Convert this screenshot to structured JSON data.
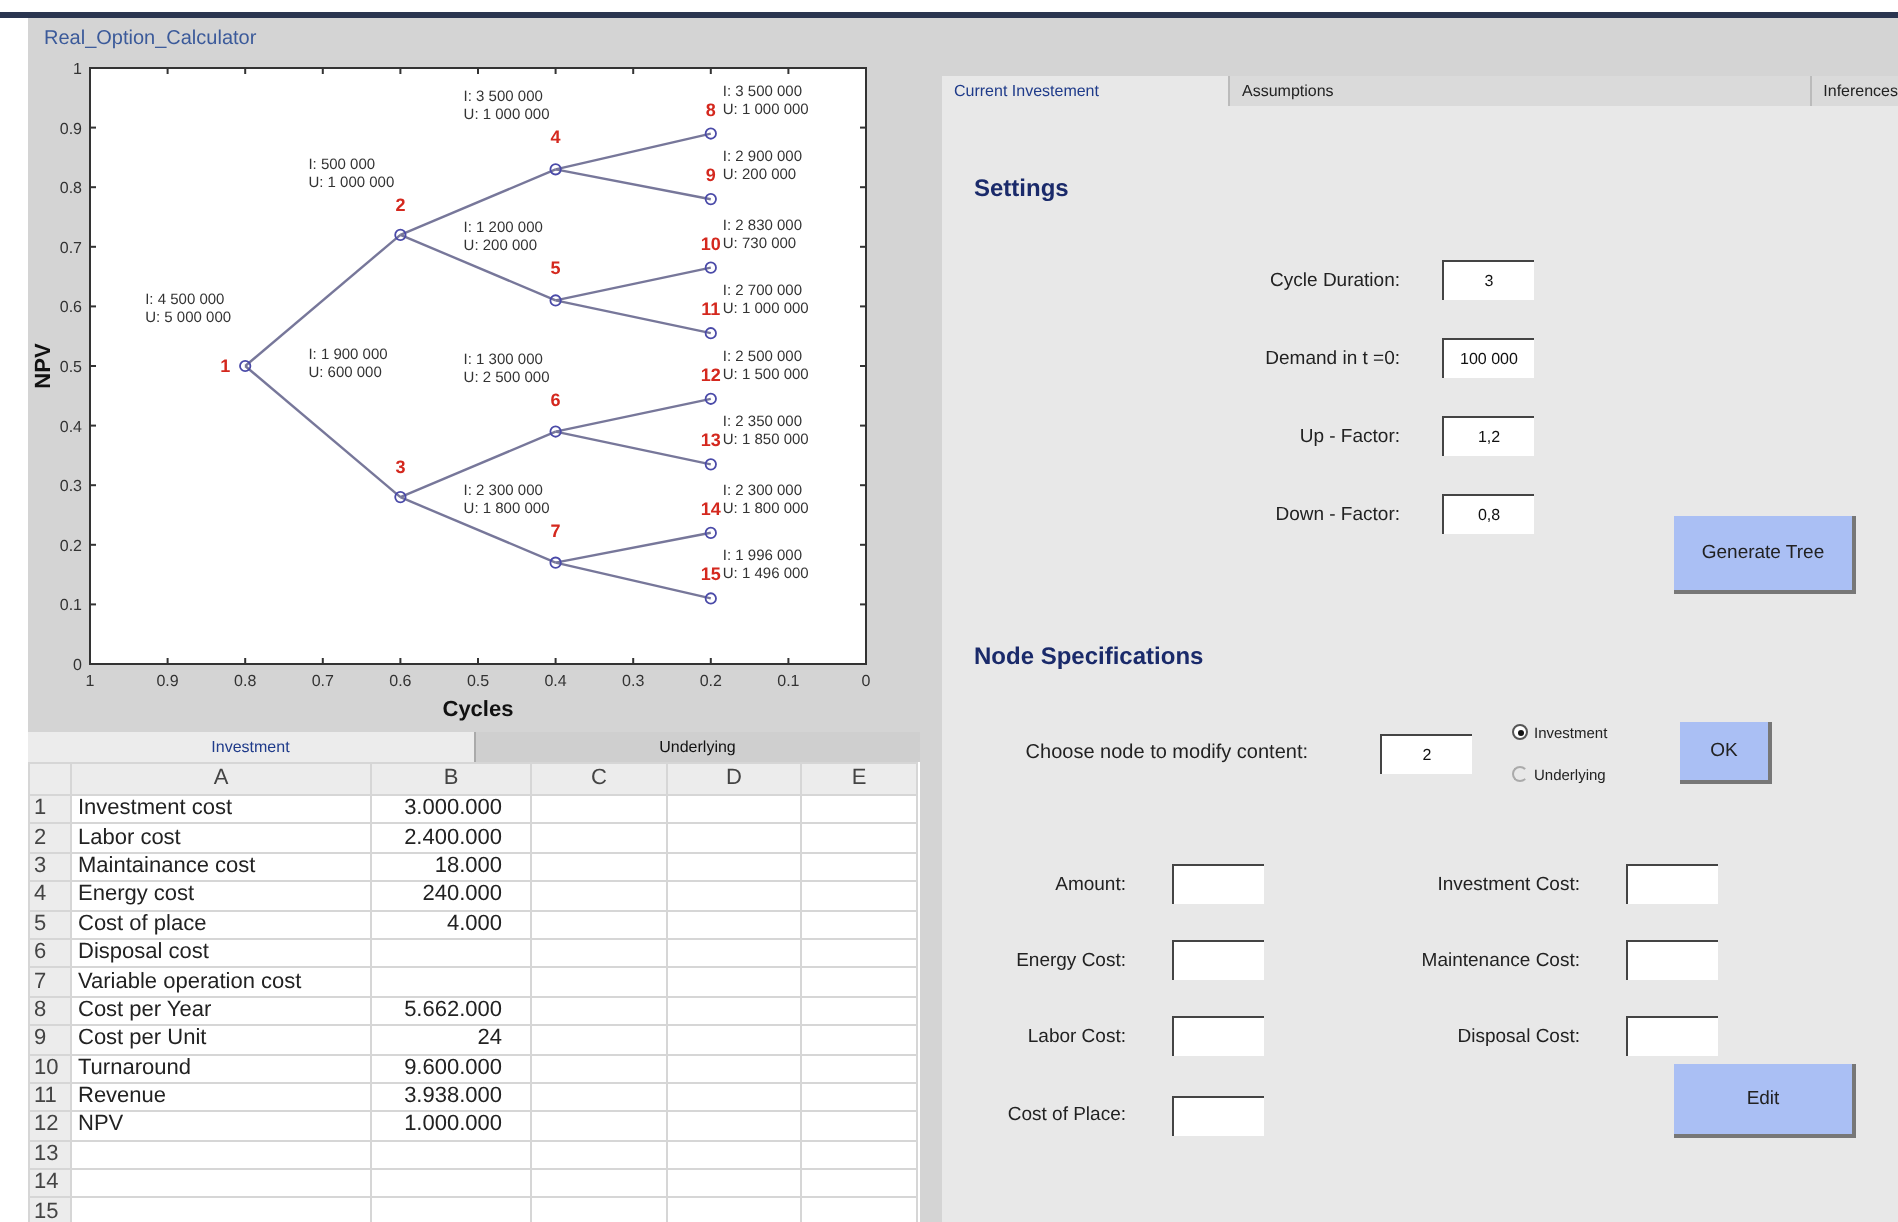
{
  "window": {
    "title": "Real_Option_Calculator"
  },
  "tree_plot": {
    "chart_data": {
      "type": "line",
      "xlabel": "Cycles",
      "ylabel": "NPV",
      "xlim": [
        1,
        0
      ],
      "ylim": [
        0,
        1
      ],
      "xticks": [
        1,
        0.9,
        0.8,
        0.7,
        0.6,
        0.5,
        0.4,
        0.3,
        0.2,
        0.1,
        0
      ],
      "yticks": [
        0,
        0.1,
        0.2,
        0.3,
        0.4,
        0.5,
        0.6,
        0.7,
        0.8,
        0.9,
        1
      ],
      "x": [
        0.8,
        0.6,
        0.4,
        0.2
      ],
      "series": [
        {
          "marker": "circle",
          "values": [
            0.5,
            0.72,
            null,
            null
          ]
        },
        {
          "marker": "circle",
          "values": [
            0.5,
            0.28,
            null,
            null
          ]
        },
        {
          "marker": "circle",
          "values": [
            null,
            0.72,
            0.83,
            null
          ]
        },
        {
          "marker": "circle",
          "values": [
            null,
            0.72,
            0.61,
            null
          ]
        },
        {
          "marker": "circle",
          "values": [
            null,
            0.28,
            0.39,
            null
          ]
        },
        {
          "marker": "circle",
          "values": [
            null,
            0.28,
            0.17,
            null
          ]
        },
        {
          "marker": "circle",
          "values": [
            null,
            null,
            0.83,
            0.89
          ]
        },
        {
          "marker": "circle",
          "values": [
            null,
            null,
            0.83,
            0.78
          ]
        },
        {
          "marker": "circle",
          "values": [
            null,
            null,
            0.61,
            0.665
          ]
        },
        {
          "marker": "circle",
          "values": [
            null,
            null,
            0.61,
            0.555
          ]
        },
        {
          "marker": "circle",
          "values": [
            null,
            null,
            0.39,
            0.445
          ]
        },
        {
          "marker": "circle",
          "values": [
            null,
            null,
            0.39,
            0.335
          ]
        },
        {
          "marker": "circle",
          "values": [
            null,
            null,
            0.17,
            0.22
          ]
        },
        {
          "marker": "circle",
          "values": [
            null,
            null,
            0.17,
            0.11
          ]
        }
      ]
    },
    "nodes": [
      {
        "number": "1",
        "investment": "I: 4 500 000",
        "underlying": "U: 5 000 000"
      },
      {
        "number": "2",
        "investment": "I: 500 000",
        "underlying": "U: 1 000 000"
      },
      {
        "number": "3",
        "investment": "I: 1 900 000",
        "underlying": "U: 600 000"
      },
      {
        "number": "4",
        "investment": "I: 3 500 000",
        "underlying": "U: 1 000 000"
      },
      {
        "number": "5",
        "investment": "I: 1 200 000",
        "underlying": "U: 200 000"
      },
      {
        "number": "6",
        "investment": "I: 1 300 000",
        "underlying": "U: 2 500 000"
      },
      {
        "number": "7",
        "investment": "I: 2 300 000",
        "underlying": "U: 1 800 000"
      },
      {
        "number": "8",
        "investment": "I: 3 500 000",
        "underlying": "U: 1 000 000"
      },
      {
        "number": "9",
        "investment": "I: 2 900 000",
        "underlying": "U: 200 000"
      },
      {
        "number": "10",
        "investment": "I: 2 830 000",
        "underlying": "U: 730 000"
      },
      {
        "number": "11",
        "investment": "I: 2 700 000",
        "underlying": "U: 1 000 000"
      },
      {
        "number": "12",
        "investment": "I: 2 500 000",
        "underlying": "U: 1 500 000"
      },
      {
        "number": "13",
        "investment": "I: 2 350 000",
        "underlying": "U: 1 850 000"
      },
      {
        "number": "14",
        "investment": "I: 2 300 000",
        "underlying": "U: 1 800 000"
      },
      {
        "number": "15",
        "investment": "I: 1 996 000",
        "underlying": "U: 1 496 000"
      }
    ]
  },
  "sheet_tabs": [
    {
      "label": "Investment",
      "selected": true
    },
    {
      "label": "Underlying",
      "selected": false
    }
  ],
  "spreadsheet": {
    "columns": [
      "A",
      "B",
      "C",
      "D",
      "E"
    ],
    "rows": [
      {
        "number": "1",
        "cells": [
          "Investment cost",
          "3.000.000"
        ]
      },
      {
        "number": "2",
        "cells": [
          "Labor cost",
          "2.400.000"
        ]
      },
      {
        "number": "3",
        "cells": [
          "Maintainance cost",
          "18.000"
        ]
      },
      {
        "number": "4",
        "cells": [
          "Energy cost",
          "240.000"
        ]
      },
      {
        "number": "5",
        "cells": [
          "Cost of place",
          "4.000"
        ]
      },
      {
        "number": "6",
        "cells": [
          "Disposal cost"
        ]
      },
      {
        "number": "7",
        "cells": [
          "Variable operation cost"
        ]
      },
      {
        "number": "8",
        "cells": [
          "Cost per Year",
          "5.662.000"
        ]
      },
      {
        "number": "9",
        "cells": [
          "Cost per Unit",
          "24"
        ]
      },
      {
        "number": "10",
        "cells": [
          "Turnaround",
          "9.600.000"
        ]
      },
      {
        "number": "11",
        "cells": [
          "Revenue",
          "3.938.000"
        ]
      },
      {
        "number": "12",
        "cells": [
          "NPV",
          "1.000.000"
        ]
      },
      {
        "number": "13"
      },
      {
        "number": "14"
      },
      {
        "number": "15"
      }
    ]
  },
  "panel_tabs": [
    {
      "label": "Current Investement",
      "selected": true
    },
    {
      "label": "Assumptions",
      "selected": false
    },
    {
      "label": "Inferences",
      "selected": false
    }
  ],
  "settings": {
    "heading": "Settings",
    "fields": [
      {
        "label": "Cycle Duration:",
        "value": "3"
      },
      {
        "label": "Demand in t =0:",
        "value": "100 000"
      },
      {
        "label": "Up - Factor:",
        "value": "1,2"
      },
      {
        "label": "Down - Factor:",
        "value": "0,8"
      }
    ],
    "button": "Generate Tree"
  },
  "node_specifications": {
    "heading": "Node Specifications",
    "prompt": "Choose node to modify content:",
    "node_value": "2",
    "options": [
      {
        "label": "Investment",
        "selected": true
      },
      {
        "label": "Underlying",
        "selected": false
      }
    ],
    "ok_button": "OK",
    "fields": [
      {
        "label": "Amount:"
      },
      {
        "label": "Investment Cost:"
      },
      {
        "label": "Energy Cost:"
      },
      {
        "label": "Maintenance Cost:"
      },
      {
        "label": "Labor Cost:"
      },
      {
        "label": "Disposal Cost:"
      },
      {
        "label": "Cost of Place:"
      }
    ],
    "edit_button": "Edit"
  }
}
